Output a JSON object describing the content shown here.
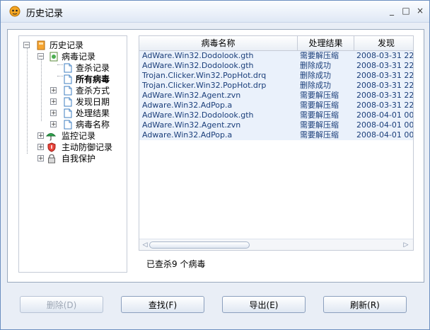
{
  "window": {
    "title": "历史记录"
  },
  "titlebar_buttons": {
    "minimize": "_",
    "maximize": "□",
    "close": "×"
  },
  "tree": [
    {
      "label": "历史记录",
      "icon": "history-book-icon",
      "expander": "−"
    },
    {
      "label": "病毒记录",
      "icon": "virus-record-icon",
      "expander": "−"
    },
    {
      "label": "查杀记录",
      "icon": "document-icon"
    },
    {
      "label": "所有病毒",
      "icon": "document-icon",
      "selected": true
    },
    {
      "label": "查杀方式",
      "icon": "document-icon",
      "expander": "+"
    },
    {
      "label": "发现日期",
      "icon": "document-icon",
      "expander": "+"
    },
    {
      "label": "处理结果",
      "icon": "document-icon",
      "expander": "+"
    },
    {
      "label": "病毒名称",
      "icon": "document-icon",
      "expander": "+"
    },
    {
      "label": "监控记录",
      "icon": "umbrella-icon",
      "expander": "+"
    },
    {
      "label": "主动防御记录",
      "icon": "shield-icon",
      "expander": "+"
    },
    {
      "label": "自我保护",
      "icon": "lock-icon",
      "expander": "+"
    }
  ],
  "grid": {
    "columns": [
      "病毒名称",
      "处理结果",
      "发现"
    ],
    "rows": [
      [
        "AdWare.Win32.Dodolook.gth",
        "需要解压缩",
        "2008-03-31 22:"
      ],
      [
        "AdWare.Win32.Dodolook.gth",
        "删除成功",
        "2008-03-31 22:"
      ],
      [
        "Trojan.Clicker.Win32.PopHot.drq",
        "删除成功",
        "2008-03-31 22:"
      ],
      [
        "Trojan.Clicker.Win32.PopHot.drp",
        "删除成功",
        "2008-03-31 22:"
      ],
      [
        "AdWare.Win32.Agent.zvn",
        "需要解压缩",
        "2008-03-31 22:"
      ],
      [
        "Adware.Win32.AdPop.a",
        "需要解压缩",
        "2008-03-31 22:"
      ],
      [
        "AdWare.Win32.Dodolook.gth",
        "需要解压缩",
        "2008-04-01 00:"
      ],
      [
        "AdWare.Win32.Agent.zvn",
        "需要解压缩",
        "2008-04-01 00:"
      ],
      [
        "Adware.Win32.AdPop.a",
        "需要解压缩",
        "2008-04-01 00:"
      ]
    ],
    "scroll_left": "◁",
    "scroll_right": "▷"
  },
  "status_text": "已查杀9 个病毒",
  "buttons": {
    "delete": "删除(D)",
    "find": "查找(F)",
    "export": "导出(E)",
    "refresh": "刷新(R)"
  },
  "colors": {
    "row_bg": "#eaf1fb",
    "row_text": "#1a3e7a",
    "window_bg": "#e9eef6",
    "border": "#6b8fc0"
  }
}
